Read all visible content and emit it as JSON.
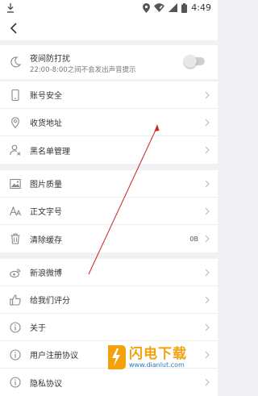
{
  "status_bar": {
    "time": "4:49"
  },
  "dnd": {
    "title": "夜间防打扰",
    "subtitle": "22:00-8:00之间不会发出声音提示",
    "enabled": false
  },
  "section1": [
    {
      "label": "账号安全",
      "icon": "phone-icon"
    },
    {
      "label": "收货地址",
      "icon": "location-pin-icon"
    },
    {
      "label": "黑名单管理",
      "icon": "user-block-icon"
    }
  ],
  "section2": [
    {
      "label": "图片质量",
      "icon": "image-icon"
    },
    {
      "label": "正文字号",
      "icon": "font-size-icon"
    },
    {
      "label": "清除缓存",
      "icon": "trash-icon",
      "value": "0B"
    }
  ],
  "section3": [
    {
      "label": "新浪微博",
      "icon": "weibo-icon"
    },
    {
      "label": "给我们评分",
      "icon": "thumbs-up-icon"
    },
    {
      "label": "关于",
      "icon": "info-icon"
    },
    {
      "label": "用户注册协议",
      "icon": "info-icon"
    },
    {
      "label": "隐私协议",
      "icon": "info-icon"
    }
  ],
  "watermark": {
    "brand": "闪电下载",
    "url": "www.dianlut.com"
  },
  "colors": {
    "accent_arrow": "#cc2222",
    "brand": "#f2a20d"
  }
}
